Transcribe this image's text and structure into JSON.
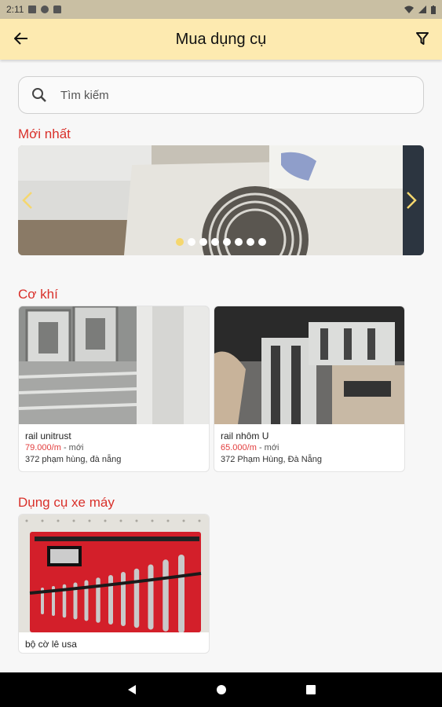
{
  "status": {
    "time": "2:11"
  },
  "appbar": {
    "title": "Mua dụng cụ",
    "back_icon": "arrow-left-icon",
    "filter_icon": "filter-icon"
  },
  "search": {
    "placeholder": "Tìm kiếm",
    "icon": "search-icon"
  },
  "sections": {
    "newest": {
      "title": "Mới nhất",
      "carousel": {
        "slide_count": 8,
        "active_index": 0
      }
    },
    "mechanical": {
      "title": "Cơ khí"
    },
    "motorbike": {
      "title": "Dụng cụ xe máy"
    }
  },
  "products": [
    {
      "name": "rail unitrust",
      "price": "79.000/m",
      "condition": "- mới",
      "address": "372 phạm hùng, đà nẵng"
    },
    {
      "name": "rail nhôm U",
      "price": "65.000/m",
      "condition": "- mới",
      "address": "372 Phạm Hùng, Đà Nẵng"
    },
    {
      "name": "bộ cờ lê usa"
    }
  ],
  "colors": {
    "appbar": "#fdeab0",
    "accent_red": "#d9302a",
    "price_red": "#e23c3c"
  }
}
